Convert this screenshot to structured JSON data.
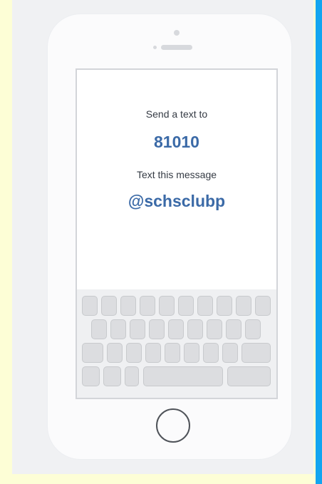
{
  "message": {
    "instruction_send": "Send a text to",
    "phone_number": "81010",
    "instruction_text": "Text this message",
    "code": "@schsclubp"
  },
  "colors": {
    "page_background": "#fdfed6",
    "accent_stripe": "#12a5f0",
    "panel_background": "#f0f1f3",
    "highlight_text": "#3b6aa7",
    "body_text": "#353b44"
  },
  "icons": {
    "home_button": "home-button-icon",
    "camera": "camera-icon",
    "speaker": "speaker-icon"
  }
}
